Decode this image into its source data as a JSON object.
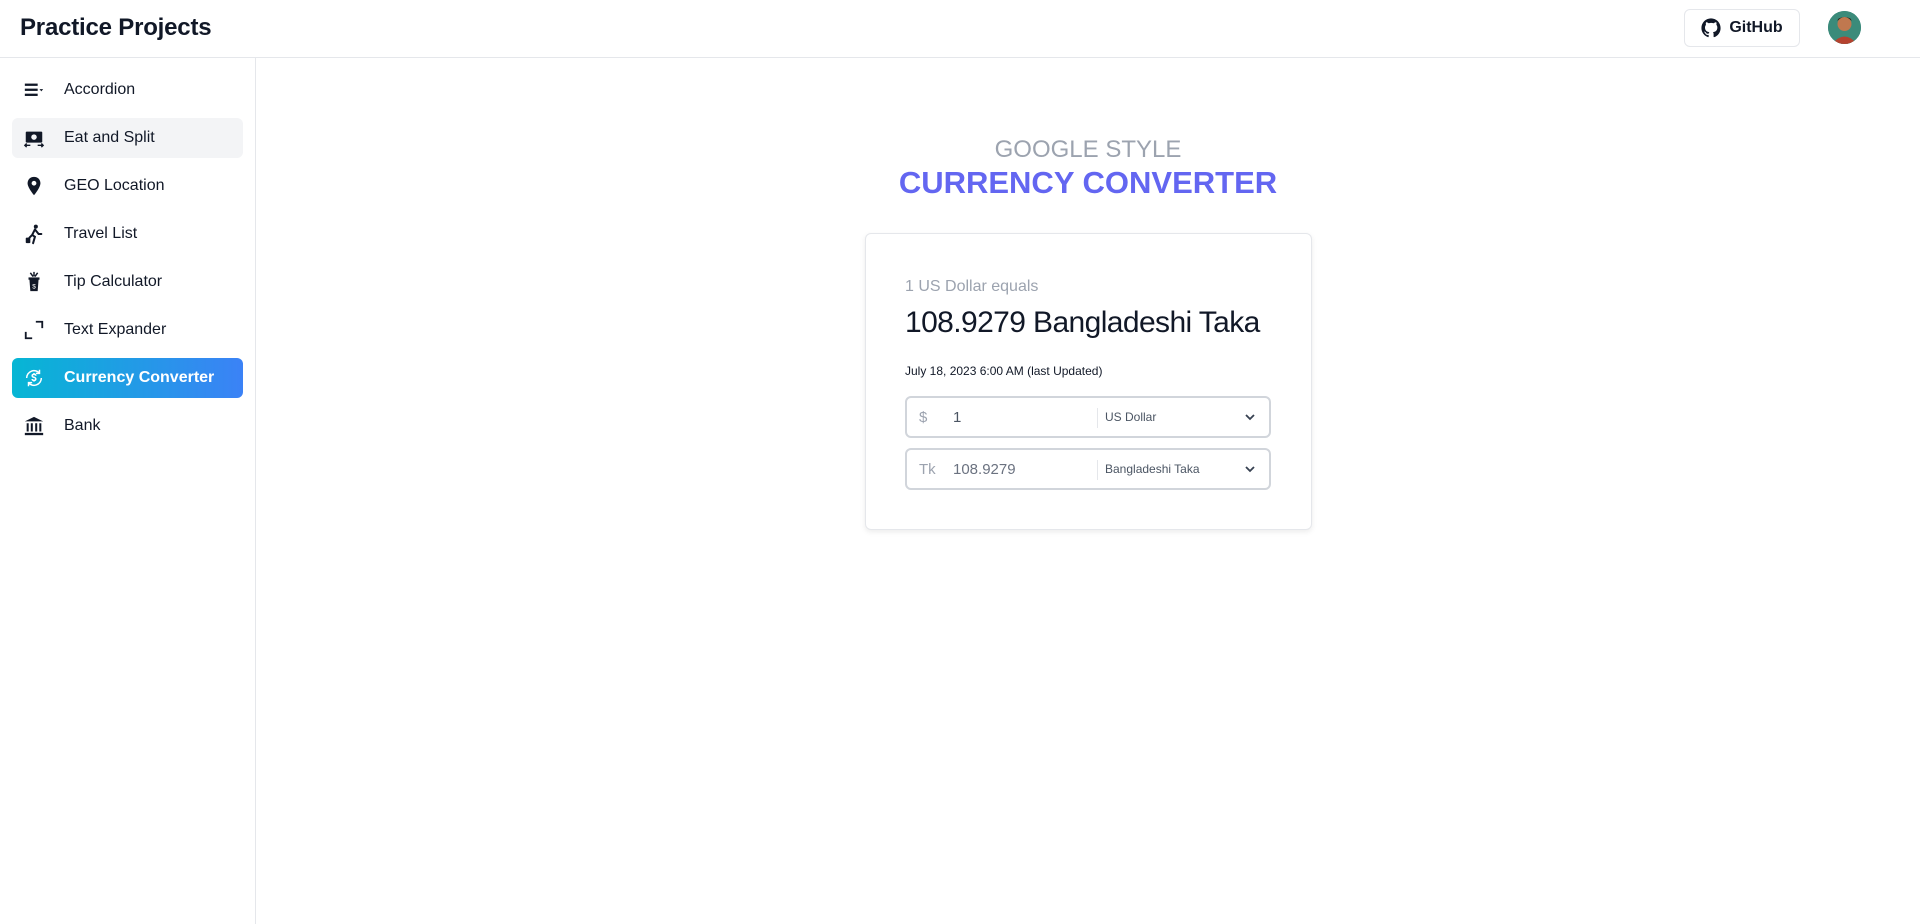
{
  "header": {
    "title": "Practice Projects",
    "github_label": "GitHub"
  },
  "sidebar": {
    "items": [
      {
        "label": "Accordion",
        "icon": "accordion-icon"
      },
      {
        "label": "Eat and Split",
        "icon": "money-split-icon"
      },
      {
        "label": "GEO Location",
        "icon": "map-pin-icon"
      },
      {
        "label": "Travel List",
        "icon": "traveler-icon"
      },
      {
        "label": "Tip Calculator",
        "icon": "tip-jar-icon"
      },
      {
        "label": "Text Expander",
        "icon": "expand-icon"
      },
      {
        "label": "Currency Converter",
        "icon": "currency-exchange-icon"
      },
      {
        "label": "Bank",
        "icon": "bank-icon"
      }
    ],
    "active_index": 6
  },
  "page": {
    "subtitle": "GOOGLE STYLE",
    "title": "CURRENCY CONVERTER"
  },
  "converter": {
    "equals_text": "1 US Dollar equals",
    "result_text": "108.9279 Bangladeshi Taka",
    "updated_text": "July 18, 2023 6:00 AM (last Updated)",
    "from": {
      "symbol": "$",
      "value": "1",
      "currency": "US Dollar"
    },
    "to": {
      "symbol": "Tk",
      "value": "108.9279",
      "currency": "Bangladeshi Taka"
    }
  },
  "colors": {
    "accent_title": "#6366f1",
    "active_gradient_start": "#06b6d4",
    "active_gradient_end": "#3b82f6"
  }
}
